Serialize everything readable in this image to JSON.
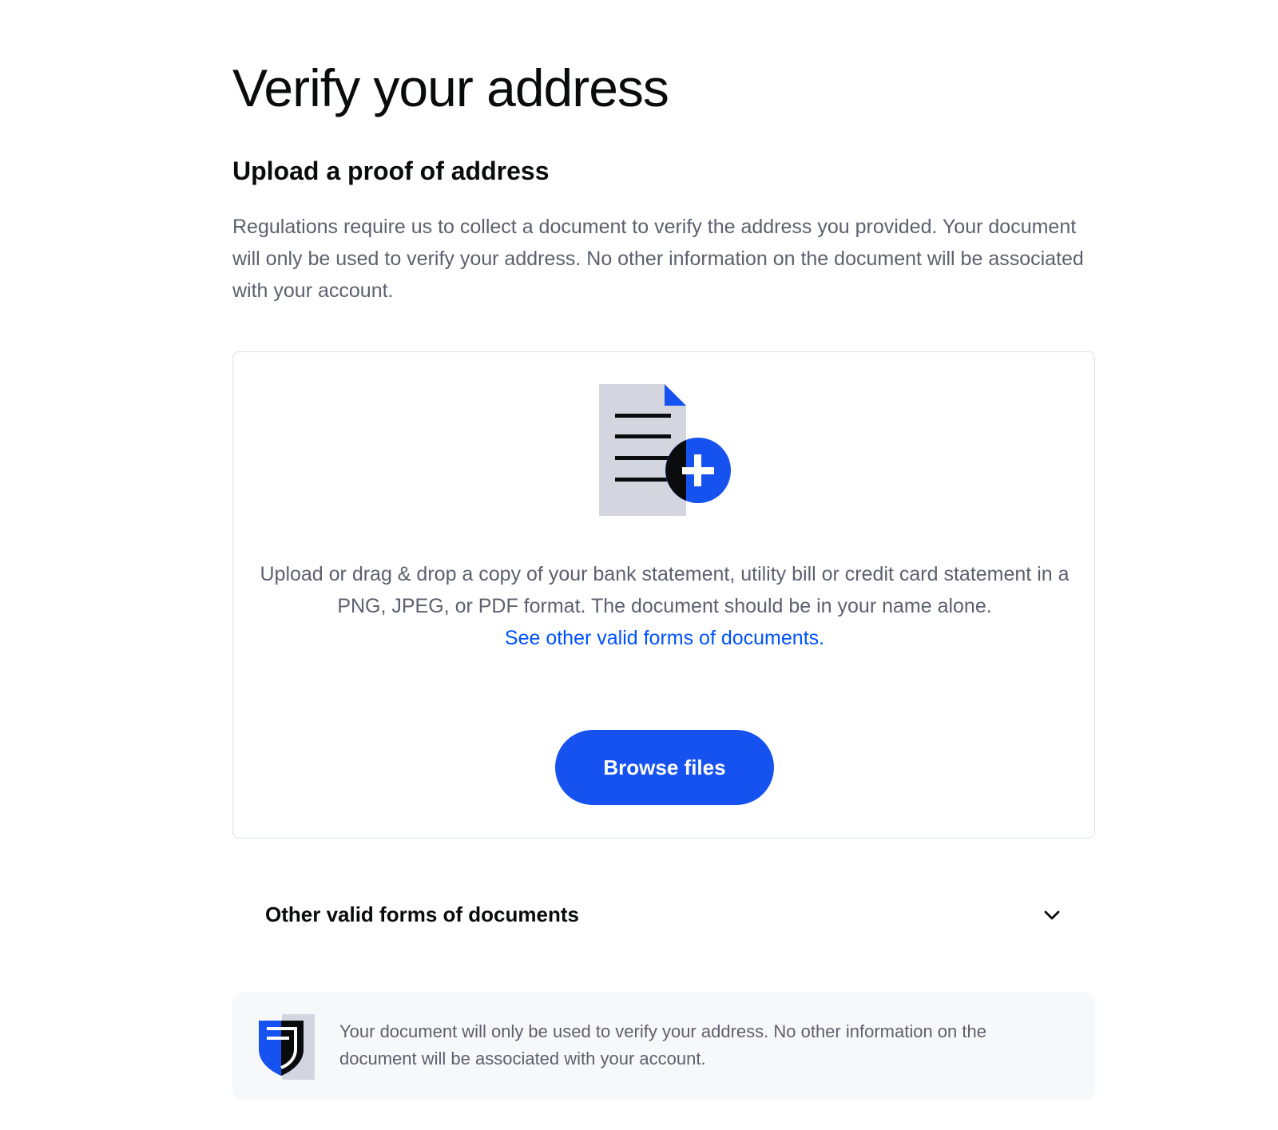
{
  "page": {
    "title": "Verify your address"
  },
  "section": {
    "title": "Upload a proof of address",
    "intro": "Regulations require us to collect a document to verify the address you provided. Your document will only be used to verify your address. No other information on the document will be associated with your account."
  },
  "upload": {
    "illustration_icon": "document-add-icon",
    "instructions": "Upload or drag & drop a copy of your bank statement, utility bill or credit card statement in a PNG, JPEG, or PDF format. The document should be in your name alone.",
    "link_label": "See other valid forms of documents.",
    "button_label": "Browse files"
  },
  "accordion": {
    "title": "Other valid forms of documents",
    "icon": "chevron-down-icon"
  },
  "notice": {
    "icon": "shield-icon",
    "text": "Your document will only be used to verify your address. No other information on the document will be associated with your account."
  },
  "colors": {
    "accent": "#1652f0",
    "link": "#0052ff",
    "text_primary": "#0a0b0d",
    "text_secondary": "#5b616e",
    "notice_background": "#f7f8fa",
    "border": "#dee1e6"
  }
}
